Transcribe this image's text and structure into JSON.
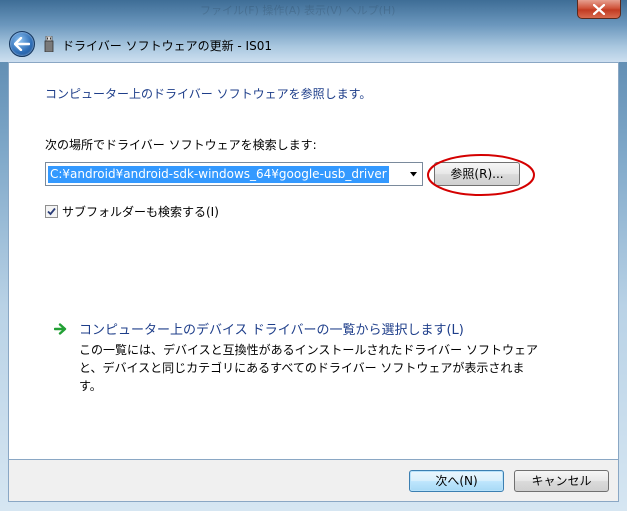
{
  "window": {
    "title": "ドライバー ソフトウェアの更新 - IS01",
    "background_text": "ファイル(F)  操作(A)  表示(V)  ヘルプ(H)"
  },
  "content": {
    "heading": "コンピューター上のドライバー ソフトウェアを参照します。",
    "search_label": "次の場所でドライバー ソフトウェアを検索します:",
    "path_value": "C:¥android¥android-sdk-windows_64¥google-usb_driver",
    "browse_button": "参照(R)...",
    "include_subfolders": "サブフォルダーも検索する(I)",
    "include_subfolders_checked": true
  },
  "pick_list": {
    "title": "コンピューター上のデバイス ドライバーの一覧から選択します(L)",
    "description_lines": [
      "この一覧には、デバイスと互換性があるインストールされたドライバー ソフトウェア",
      "と、デバイスと同じカテゴリにあるすべてのドライバー ソフトウェアが表示されま",
      "す。"
    ]
  },
  "footer": {
    "next_button": "次へ(N)",
    "cancel_button": "キャンセル"
  },
  "colors": {
    "heading_blue": "#1e3e8a",
    "selection_blue": "#3399ff",
    "annotation_red": "#d40000",
    "arrow_green": "#22a035"
  },
  "icons": {
    "back": "back-arrow-icon",
    "device": "usb-device-icon",
    "close": "close-icon",
    "link": "green-arrow-icon",
    "dropdown": "chevron-down-icon",
    "check": "checkmark-icon"
  }
}
